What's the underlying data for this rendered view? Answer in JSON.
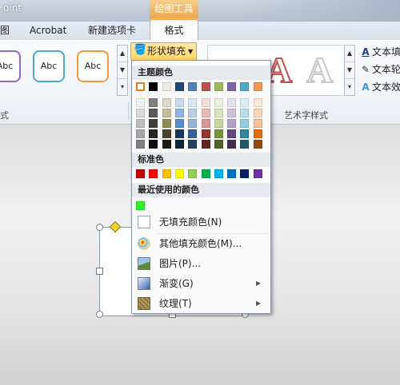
{
  "titlebar": {
    "app_fragment": "oint",
    "context_tool": "绘图工具"
  },
  "tabs": [
    "图",
    "Acrobat",
    "新建选项卡",
    "格式"
  ],
  "ribbon": {
    "shape_styles": [
      {
        "label": "Abc",
        "color": "#8e6ac3"
      },
      {
        "label": "Abc",
        "color": "#4baacc"
      },
      {
        "label": "Abc",
        "color": "#f29b3d"
      }
    ],
    "shape_styles_group_label": "式",
    "wordart_group_label": "艺术字样式",
    "wordart_glyphs": [
      "A",
      "A"
    ],
    "text_commands": [
      "文本填",
      "文本轮",
      "文本效"
    ]
  },
  "fill_button": {
    "label": "形状填充",
    "dropdown_icon": "triangle-down-icon"
  },
  "fill_menu": {
    "theme_header": "主题颜色",
    "theme_colors": [
      "#FFFFFF",
      "#000000",
      "#EEECE1",
      "#1F497D",
      "#4F81BD",
      "#C0504D",
      "#9BBB59",
      "#8064A2",
      "#4BACC6",
      "#F79646"
    ],
    "theme_shades": [
      [
        "#F2F2F2",
        "#808080",
        "#DDD9C4",
        "#C6D9F1",
        "#DCE6F2",
        "#F2DCDB",
        "#EBF1DE",
        "#E6E0EC",
        "#DBEEF4",
        "#FDEADA"
      ],
      [
        "#D9D9D9",
        "#595959",
        "#C4BD97",
        "#8DB4E3",
        "#B9CDE5",
        "#E6B9B8",
        "#D7E4BD",
        "#CCC1DA",
        "#B7DEE8",
        "#FCD5B5"
      ],
      [
        "#BFBFBF",
        "#404040",
        "#948A54",
        "#558ED5",
        "#95B3D7",
        "#D99694",
        "#C3D69B",
        "#B3A2C7",
        "#93CDDD",
        "#FAC090"
      ],
      [
        "#A6A6A6",
        "#262626",
        "#4A452A",
        "#17375E",
        "#376092",
        "#953735",
        "#77933C",
        "#604A7B",
        "#31859C",
        "#E46C0A"
      ],
      [
        "#808080",
        "#0D0D0D",
        "#1E1C11",
        "#10243F",
        "#254061",
        "#632523",
        "#4F6228",
        "#3F3151",
        "#215968",
        "#984807"
      ]
    ],
    "standard_header": "标准色",
    "standard_colors": [
      "#C00000",
      "#FF0000",
      "#FFC000",
      "#FFFF00",
      "#92D050",
      "#00B050",
      "#00B0F0",
      "#0070C0",
      "#002060",
      "#7030A0"
    ],
    "recent_header": "最近使用的颜色",
    "recent_colors": [
      "#33EE33"
    ],
    "no_fill_label": "无填充颜色(N)",
    "more_colors_label": "其他填充颜色(M)...",
    "picture_label": "图片(P)...",
    "gradient_label": "渐变(G)",
    "texture_label": "纹理(T)"
  }
}
